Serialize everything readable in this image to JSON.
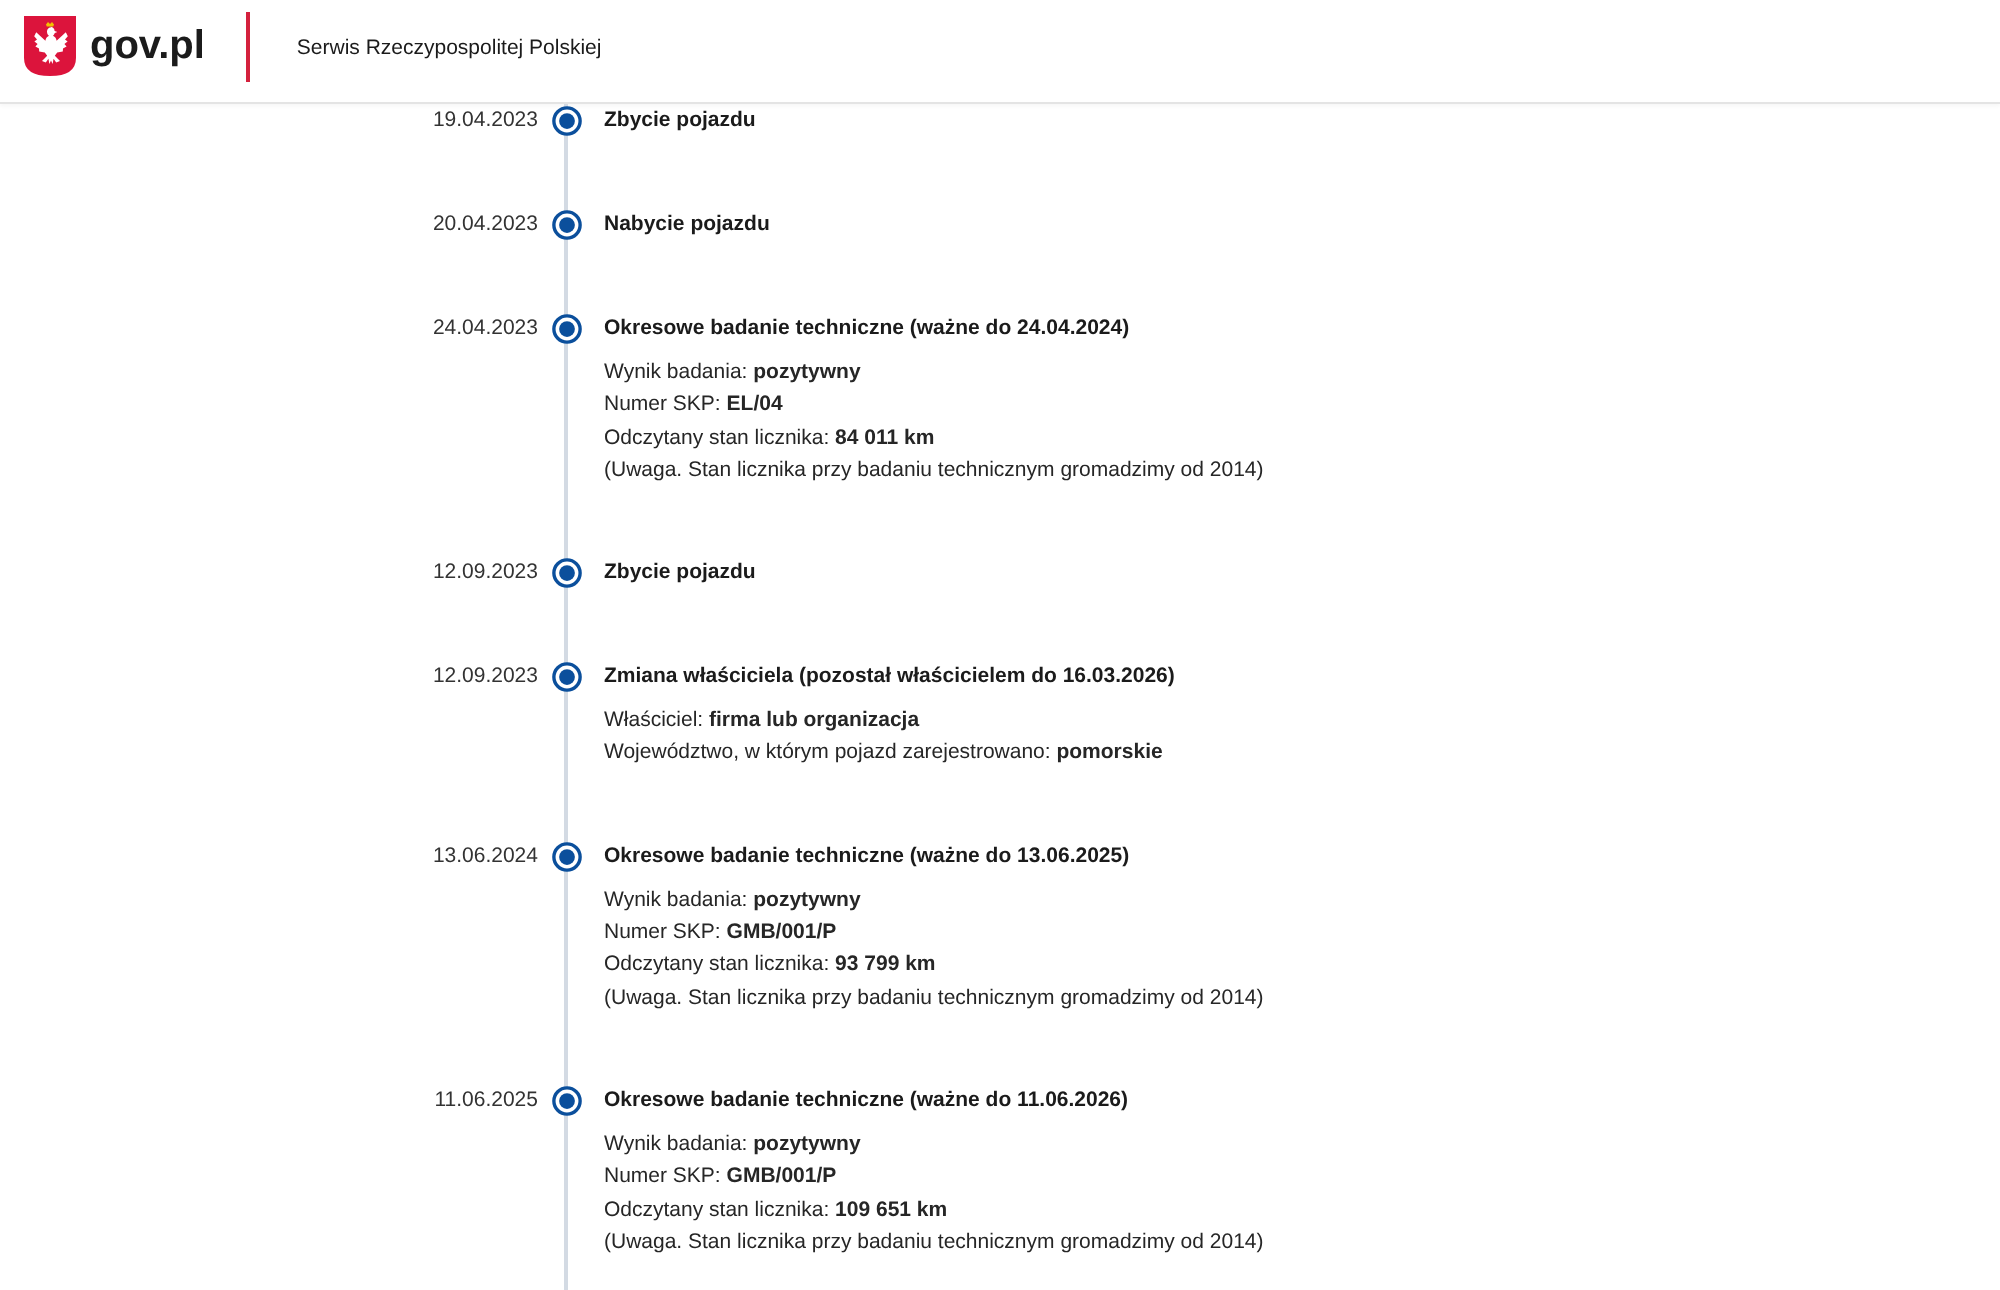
{
  "header": {
    "logo_text": "gov.pl",
    "service_name": "Serwis Rzeczypospolitej Polskiej"
  },
  "timeline": [
    {
      "date": "19.04.2023",
      "title": "Zbycie pojazdu"
    },
    {
      "date": "20.04.2023",
      "title": "Nabycie pojazdu"
    },
    {
      "date": "24.04.2023",
      "title": "Okresowe badanie techniczne (ważne do 24.04.2024)",
      "details": [
        "Wynik badania: **pozytywny**",
        "Numer SKP: **EL/04**",
        "Odczytany stan licznika: **84 011 km**",
        "(Uwaga. Stan licznika przy badaniu technicznym gromadzimy od 2014)"
      ]
    },
    {
      "date": "12.09.2023",
      "title": "Zbycie pojazdu"
    },
    {
      "date": "12.09.2023",
      "title": "Zmiana właściciela (pozostał właścicielem do 16.03.2026)",
      "details": [
        "Właściciel: **firma lub organizacja**",
        "Województwo, w którym pojazd zarejestrowano: **pomorskie**"
      ]
    },
    {
      "date": "13.06.2024",
      "title": "Okresowe badanie techniczne (ważne do 13.06.2025)",
      "details": [
        "Wynik badania: **pozytywny**",
        "Numer SKP: **GMB/001/P**",
        "Odczytany stan licznika: **93 799 km**",
        "(Uwaga. Stan licznika przy badaniu technicznym gromadzimy od 2014)"
      ]
    },
    {
      "date": "11.06.2025",
      "title": "Okresowe badanie techniczne (ważne do 11.06.2026)",
      "details": [
        "Wynik badania: **pozytywny**",
        "Numer SKP: **GMB/001/P**",
        "Odczytany stan licznika: **109 651 km**",
        "(Uwaga. Stan licznika przy badaniu technicznym gromadzimy od 2014)"
      ]
    }
  ]
}
